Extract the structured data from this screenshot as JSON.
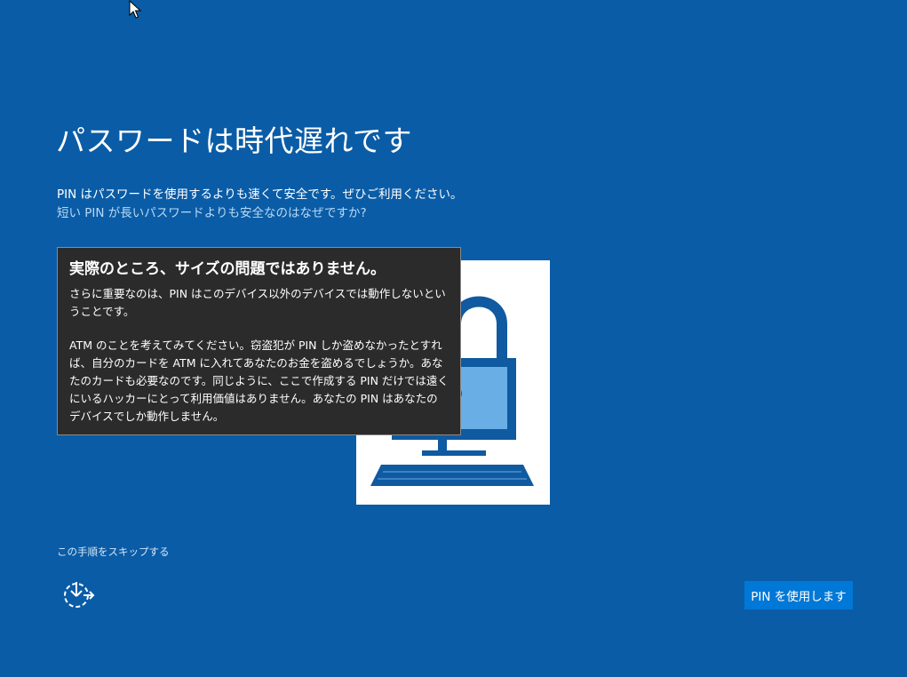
{
  "window": {
    "background_color": "#0a5ca6"
  },
  "header": {
    "title": "パスワードは時代遅れです",
    "subtitle": "PIN はパスワードを使用するよりも速くて安全です。ぜひご利用ください。",
    "help_link": "短い PIN が長いパスワードよりも安全なのはなぜですか?"
  },
  "tooltip": {
    "title": "実際のところ、サイズの問題ではありません。",
    "paragraph_1": "さらに重要なのは、PIN はこのデバイス以外のデバイスでは動作しないということです。",
    "paragraph_2": "ATM のことを考えてみてください。窃盗犯が PIN しか盗めなかったとすれば、自分のカードを ATM に入れてあなたのお金を盗めるでしょうか。あなたのカードも必要なのです。同じように、ここで作成する PIN だけでは遠くにいるハッカーにとって利用価値はありません。あなたの PIN はあなたのデバイスでしか動作しません。",
    "background_color": "#2b2b2b"
  },
  "illustration": {
    "icon": "padlock-computer-icon",
    "accent_dark": "#0f5aa0",
    "accent_light": "#6aaee6"
  },
  "footer": {
    "skip_link": "この手順をスキップする",
    "ease_of_access_icon": "ease-of-access-icon",
    "primary_button_label": "PIN を使用します",
    "primary_button_color": "#0078d7"
  },
  "cursor": {
    "icon": "mouse-pointer-icon"
  }
}
